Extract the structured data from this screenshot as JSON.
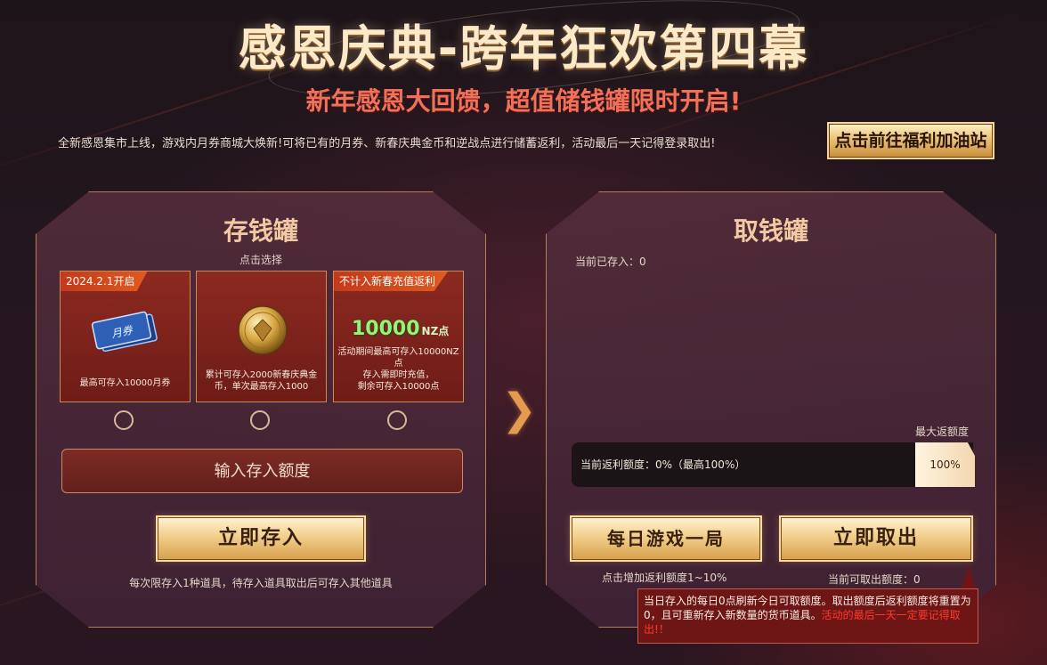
{
  "header": {
    "title": "感恩庆典-跨年狂欢第四幕",
    "subtitle": "新年感恩大回馈，超值储钱罐限时开启!",
    "intro": "全新感恩集市上线，游戏内月券商城大焕新!可将已有的月券、新春庆典金币和逆战点进行储蓄返利，活动最后一天记得登录取出!",
    "top_button": "点击前往福利加油站"
  },
  "deposit": {
    "title": "存钱罐",
    "hint": "点击选择",
    "cards": [
      {
        "tag": "2024.2.1开启",
        "icon": "ticket-icon",
        "image_text": "月券",
        "desc": "最高可存入10000月券"
      },
      {
        "tag": "",
        "icon": "gold-coin-icon",
        "image_text": "",
        "desc": "累计可存入2000新春庆典金币，单次最高存入1000"
      },
      {
        "tag": "不计入新春充值返利",
        "icon": "nz-points-icon",
        "image_text": "10000",
        "image_unit": "NZ点",
        "desc": "活动期间最高可存入10000NZ点\n存入需即时充值，\n剩余可存入10000点"
      }
    ],
    "input_placeholder": "输入存入额度",
    "submit_label": "立即存入",
    "note": "每次限存入1种道具，待存入道具取出后可存入其他道具"
  },
  "withdraw": {
    "title": "取钱罐",
    "current_stored": "当前已存入：0",
    "max_rate_label": "最大返额度",
    "bar_label": "当前返利额度：0%（最高100%）",
    "bar_cap": "100%",
    "bar_fill_fraction": 0,
    "daily_button": "每日游戏一局",
    "daily_note": "点击增加返利额度1~10%",
    "withdraw_button": "立即取出",
    "withdraw_note": "当前可取出额度：0",
    "tooltip_text": "当日存入的每日0点刷新今日可取额度。取出额度后返利额度将重置为0，且可重新存入新数量的货币道具。",
    "tooltip_warning": "活动的最后一天一定要记得取出!！"
  },
  "colors": {
    "accent_gold": "#f1cf8b",
    "accent_red": "#f07058",
    "warning_red": "#ff3a2a"
  }
}
